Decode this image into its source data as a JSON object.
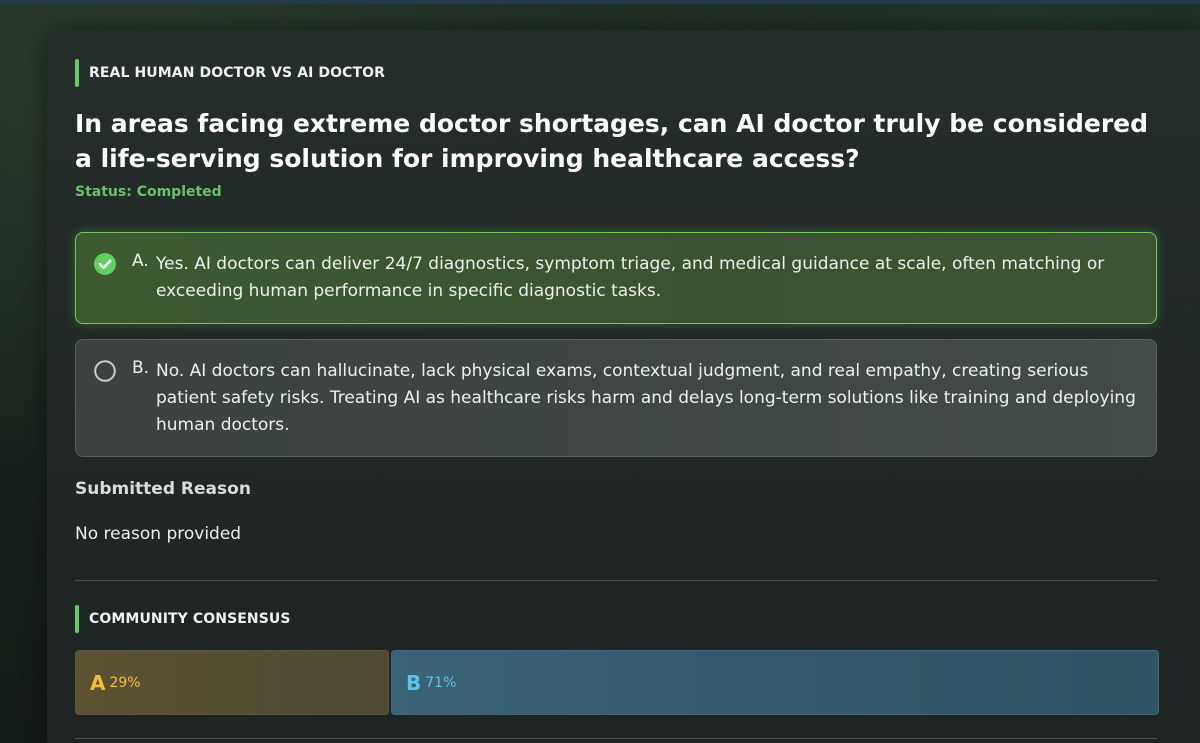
{
  "poll": {
    "category": "REAL HUMAN DOCTOR VS AI DOCTOR",
    "question": "In areas facing extreme doctor shortages, can AI doctor truly be considered a life-serving solution for improving healthcare access?",
    "status": "Status: Completed",
    "options": [
      {
        "letter": "A.",
        "text": "Yes. AI doctors can deliver 24/7 diagnostics, symptom triage, and medical guidance at scale, often matching or exceeding human performance in specific diagnostic tasks.",
        "selected": true,
        "icon": "check-circle-icon"
      },
      {
        "letter": "B.",
        "text": "No. AI doctors can hallucinate, lack physical exams, contextual judgment, and real empathy, creating serious patient safety risks. Treating AI as healthcare risks harm and delays long-term solutions like training and deploying human doctors.",
        "selected": false,
        "icon": "radio-circle-icon"
      }
    ]
  },
  "reason": {
    "label": "Submitted Reason",
    "text": "No reason provided"
  },
  "consensus": {
    "label": "COMMUNITY CONSENSUS",
    "segments": [
      {
        "letter": "A",
        "percent_text": "29%",
        "fraction": 0.29,
        "color": "#f0c23a"
      },
      {
        "letter": "B",
        "percent_text": "71%",
        "fraction": 0.71,
        "color": "#5cc3ec"
      }
    ]
  },
  "colors": {
    "accent_green": "#5fcf5f",
    "status_green": "#63c463"
  }
}
